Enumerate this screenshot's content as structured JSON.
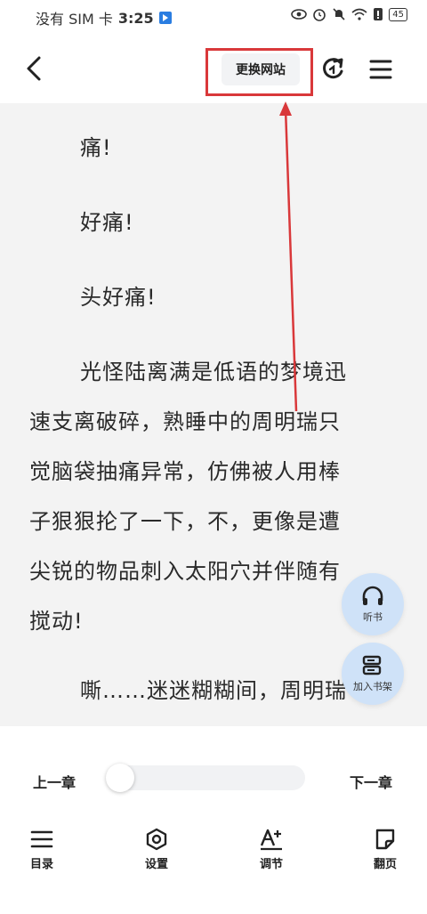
{
  "status_bar": {
    "carrier": "没有 SIM 卡",
    "time": "3:25",
    "battery": "45"
  },
  "top_bar": {
    "switch_site_label": "更换网站"
  },
  "content": {
    "paragraphs": [
      "痛!",
      "好痛!",
      "头好痛!",
      "光怪陆离满是低语的梦境迅",
      "速支离破碎，熟睡中的周明瑞只",
      "觉脑袋抽痛异常，仿佛被人用棒",
      "子狠狠抡了一下，不，更像是遭",
      "尖锐的物品刺入太阳穴并伴随有",
      "搅动!",
      "嘶……迷迷糊糊间，周明瑞"
    ]
  },
  "fabs": {
    "listen_label": "听书",
    "add_shelf_label": "加入书架"
  },
  "chapter_nav": {
    "prev_label": "上一章",
    "next_label": "下一章",
    "progress": 0
  },
  "tabs": {
    "catalog": "目录",
    "settings": "设置",
    "adjust": "调节",
    "page_turn": "翻页"
  },
  "colors": {
    "highlight": "#d9383a",
    "fab_bg": "#cfe2f8",
    "reader_bg": "#f3f3f3"
  }
}
